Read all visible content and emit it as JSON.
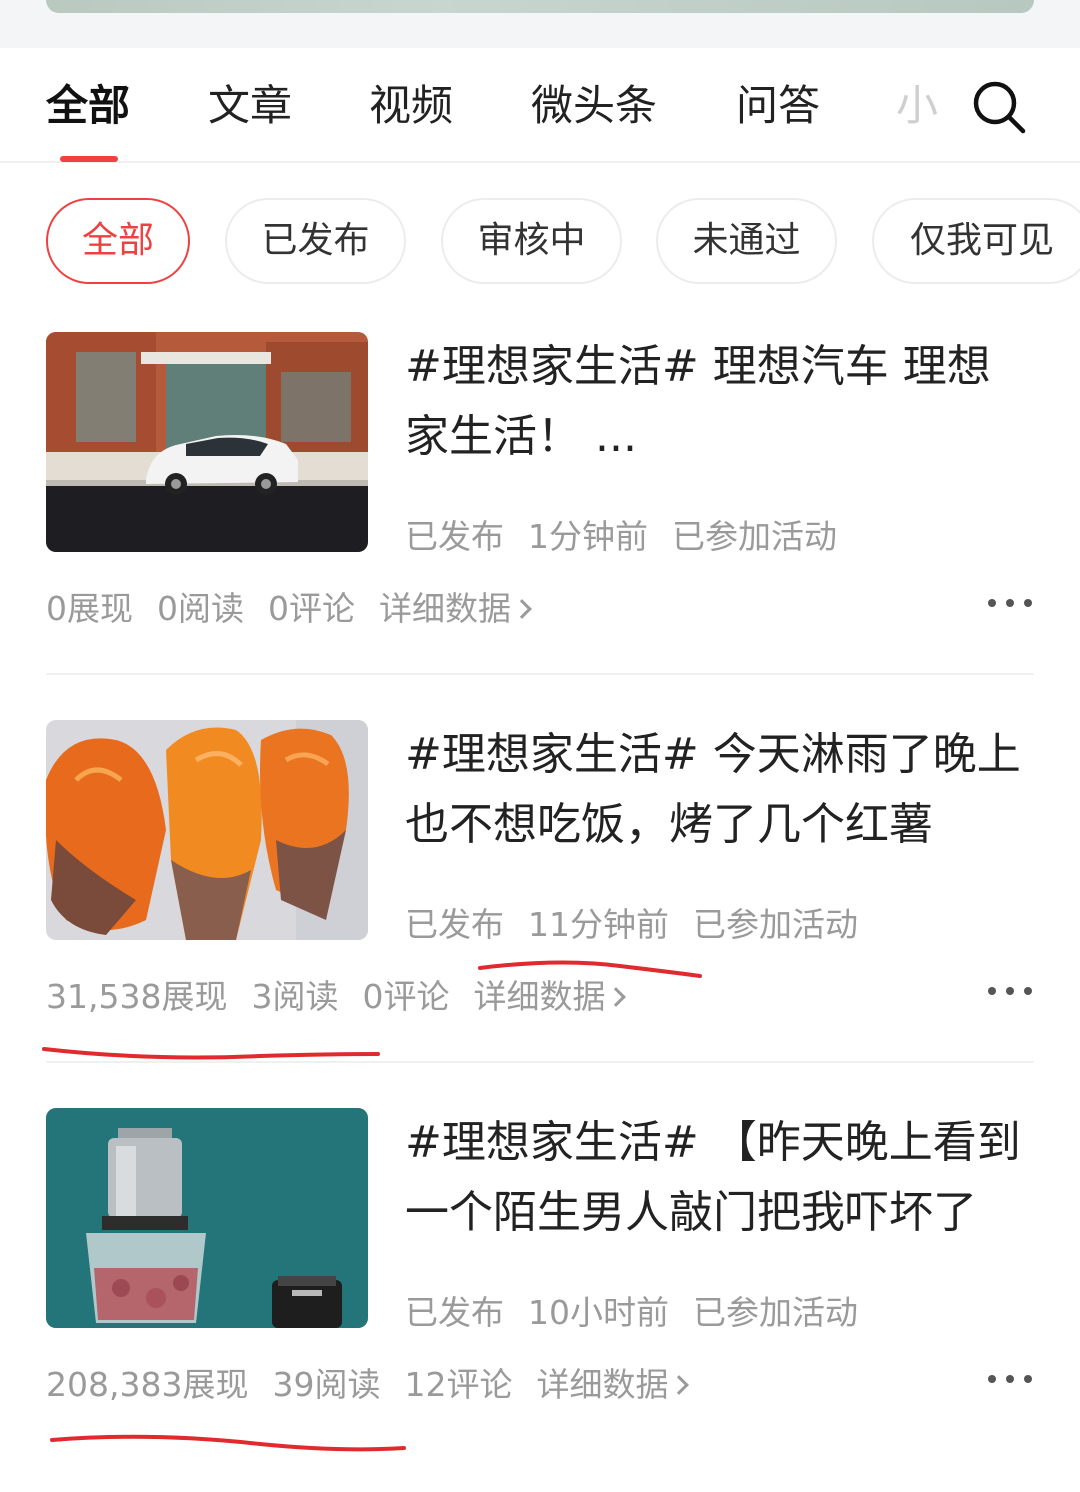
{
  "tabs": [
    "全部",
    "文章",
    "视频",
    "微头条",
    "问答",
    "小"
  ],
  "filters": [
    "全部",
    "已发布",
    "审核中",
    "未通过",
    "仅我可见"
  ],
  "articles": [
    {
      "title": "#理想家生活# 理想汽车 理想家生活！ ...",
      "status": "已发布",
      "time": "1分钟前",
      "activity": "已参加活动",
      "impressions": "0展现",
      "reads": "0阅读",
      "comments": "0评论",
      "detail": "详细数据"
    },
    {
      "title": "#理想家生活# 今天淋雨了晚上也不想吃饭，烤了几个红薯",
      "status": "已发布",
      "time": "11分钟前",
      "activity": "已参加活动",
      "impressions": "31,538展现",
      "reads": "3阅读",
      "comments": "0评论",
      "detail": "详细数据"
    },
    {
      "title": "#理想家生活# 【昨天晚上看到一个陌生男人敲门把我吓坏了",
      "status": "已发布",
      "time": "10小时前",
      "activity": "已参加活动",
      "impressions": "208,383展现",
      "reads": "39阅读",
      "comments": "12评论",
      "detail": "详细数据"
    }
  ],
  "colors": {
    "accent": "#f04142",
    "muted": "#9a9a9a",
    "divider": "#f0f0f0"
  },
  "icons": {
    "search": "search-icon",
    "more": "more-dots-icon",
    "detail_arrow": "chevron-right-icon"
  }
}
